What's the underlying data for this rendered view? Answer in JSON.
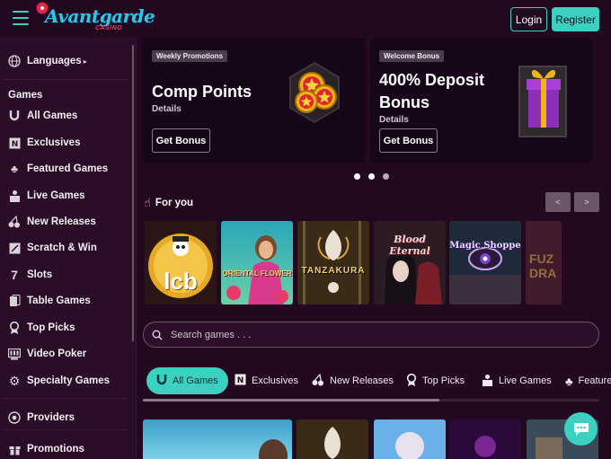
{
  "brand": {
    "name": "Avantgarde",
    "subtitle": "CASINO",
    "accent": "#3cd0c0"
  },
  "header": {
    "login_label": "Login",
    "register_label": "Register"
  },
  "sidebar": {
    "languages": "Languages",
    "games_heading": "Games",
    "items": [
      {
        "label": "All Games",
        "icon": "horseshoe-icon"
      },
      {
        "label": "Exclusives",
        "icon": "exclusive-icon"
      },
      {
        "label": "Featured Games",
        "icon": "clover-icon"
      },
      {
        "label": "Live Games",
        "icon": "live-dealer-icon"
      },
      {
        "label": "New Releases",
        "icon": "cherries-icon"
      },
      {
        "label": "Scratch & Win",
        "icon": "scratch-card-icon"
      },
      {
        "label": "Slots",
        "icon": "seven-icon"
      },
      {
        "label": "Table Games",
        "icon": "cards-icon"
      },
      {
        "label": "Top Picks",
        "icon": "trophy-icon"
      },
      {
        "label": "Video Poker",
        "icon": "video-poker-icon"
      },
      {
        "label": "Specialty Games",
        "icon": "gear-icon"
      }
    ],
    "providers": "Providers",
    "promotions": "Promotions"
  },
  "promos": [
    {
      "tag": "Weekly Promotions",
      "title": "Comp Points",
      "details": "Details",
      "button": "Get Bonus"
    },
    {
      "tag": "Welcome Bonus",
      "title_line1": "400% Deposit",
      "title_line2": "Bonus",
      "details": "Details",
      "button": "Get Bonus"
    }
  ],
  "carousel": {
    "slides": 3,
    "active": 1
  },
  "for_you": {
    "title": "For you",
    "prev": "<",
    "next": ">",
    "games": [
      {
        "label": "lcb"
      },
      {
        "label": "ORIENTAL FLOWER"
      },
      {
        "label": "TANZAKURA"
      },
      {
        "label": "Blood Eternal"
      },
      {
        "label": "Magic Shoppe"
      },
      {
        "label": "FUZ DRA"
      }
    ]
  },
  "search": {
    "placeholder": "Search games . . ."
  },
  "categories": [
    {
      "label": "All Games",
      "icon": "horseshoe-icon",
      "active": true
    },
    {
      "label": "Exclusives",
      "icon": "exclusive-icon"
    },
    {
      "label": "New Releases",
      "icon": "cherries-icon"
    },
    {
      "label": "Top Picks",
      "icon": "trophy-icon"
    },
    {
      "label": "Live Games",
      "icon": "live-dealer-icon"
    },
    {
      "label": "Featured Games",
      "icon": "clover-icon"
    }
  ]
}
